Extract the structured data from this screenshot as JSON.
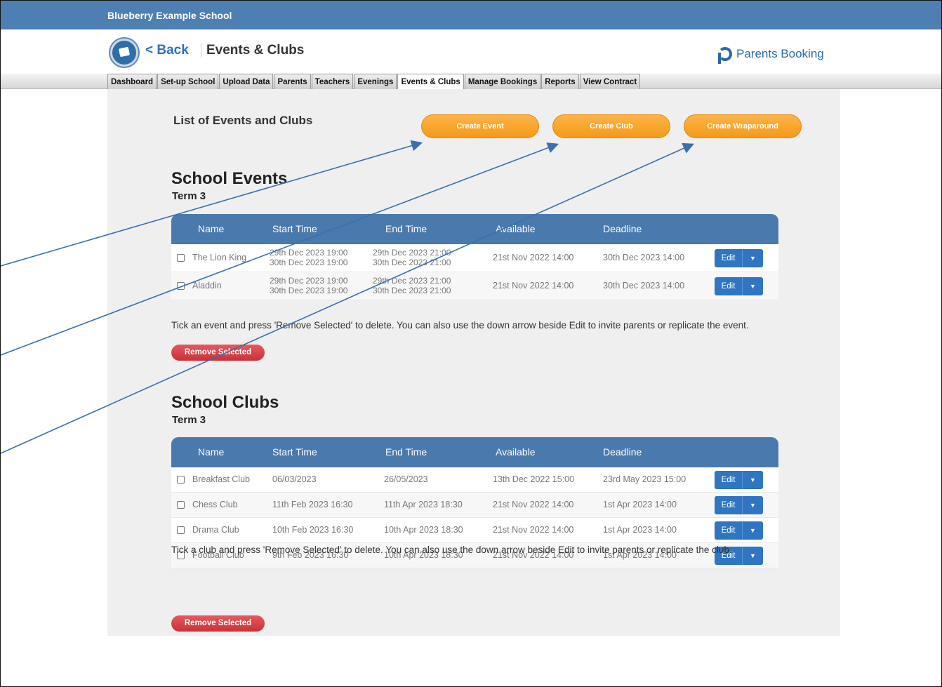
{
  "school": {
    "name": "Blueberry Example School"
  },
  "header": {
    "back_label": "< Back",
    "title": "Events & Clubs",
    "brand": "Parents Booking"
  },
  "tabs": [
    {
      "label": "Dashboard"
    },
    {
      "label": "Set-up School"
    },
    {
      "label": "Upload Data"
    },
    {
      "label": "Parents"
    },
    {
      "label": "Teachers"
    },
    {
      "label": "Evenings"
    },
    {
      "label": "Events & Clubs",
      "active": true
    },
    {
      "label": "Manage Bookings"
    },
    {
      "label": "Reports"
    },
    {
      "label": "View Contract"
    }
  ],
  "main": {
    "list_title": "List of Events and Clubs",
    "buttons": {
      "create_event": "Create Event",
      "create_club": "Create Club",
      "create_wraparound": "Create Wraparound"
    }
  },
  "columns": {
    "name": "Name",
    "start": "Start Time",
    "end": "End Time",
    "available": "Available",
    "deadline": "Deadline"
  },
  "events": {
    "title": "School Events",
    "term": "Term 3",
    "rows": [
      {
        "name": "The Lion King",
        "start1": "29th Dec 2023 19:00",
        "start2": "30th Dec 2023 19:00",
        "end1": "29th Dec 2023 21:00",
        "end2": "30th Dec 2023 21:00",
        "available": "21st Nov 2022 14:00",
        "deadline": "30th Dec 2023 14:00"
      },
      {
        "name": "Aladdin",
        "start1": "29th Dec 2023 19:00",
        "start2": "30th Dec 2023 19:00",
        "end1": "29th Dec 2023 21:00",
        "end2": "30th Dec 2023 21:00",
        "available": "21st Nov 2022 14:00",
        "deadline": "30th Dec 2023 14:00"
      }
    ],
    "note": "Tick an event and press 'Remove Selected' to delete. You can also use the down arrow beside Edit to invite parents or replicate the event.",
    "remove_label": "Remove Selected"
  },
  "clubs": {
    "title": "School Clubs",
    "term": "Term 3",
    "rows": [
      {
        "name": "Breakfast Club",
        "start": "06/03/2023",
        "end": "26/05/2023",
        "available": "13th Dec 2022 15:00",
        "deadline": "23rd May 2023 15:00"
      },
      {
        "name": "Chess Club",
        "start": "11th Feb 2023 16:30",
        "end": "11th Apr 2023 18:30",
        "available": "21st Nov 2022 14:00",
        "deadline": "1st Apr 2023 14:00"
      },
      {
        "name": "Drama Club",
        "start": "10th Feb 2023 16:30",
        "end": "10th Apr 2023 18:30",
        "available": "21st Nov 2022 14:00",
        "deadline": "1st Apr 2023 14:00"
      },
      {
        "name": "Football Club",
        "start": "9th Feb 2023 16:30",
        "end": "10th Apr 2023 18:30",
        "available": "21st Nov 2022 14:00",
        "deadline": "1st Apr 2023 14:00"
      }
    ],
    "note": "Tick a club and press 'Remove Selected' to delete. You can also use the down arrow beside Edit to invite parents or replicate the club.",
    "remove_label": "Remove Selected"
  },
  "edit_label": "Edit",
  "edit_dropdown_icon": "caret-down-icon",
  "colors": {
    "topbar": "#4e7fb3",
    "table_header": "#4a79ad",
    "orange_button": "#f39a1a",
    "remove_button": "#c8323a",
    "edit_button": "#2f75c2",
    "annotation_arrow": "#3a6fb0"
  }
}
